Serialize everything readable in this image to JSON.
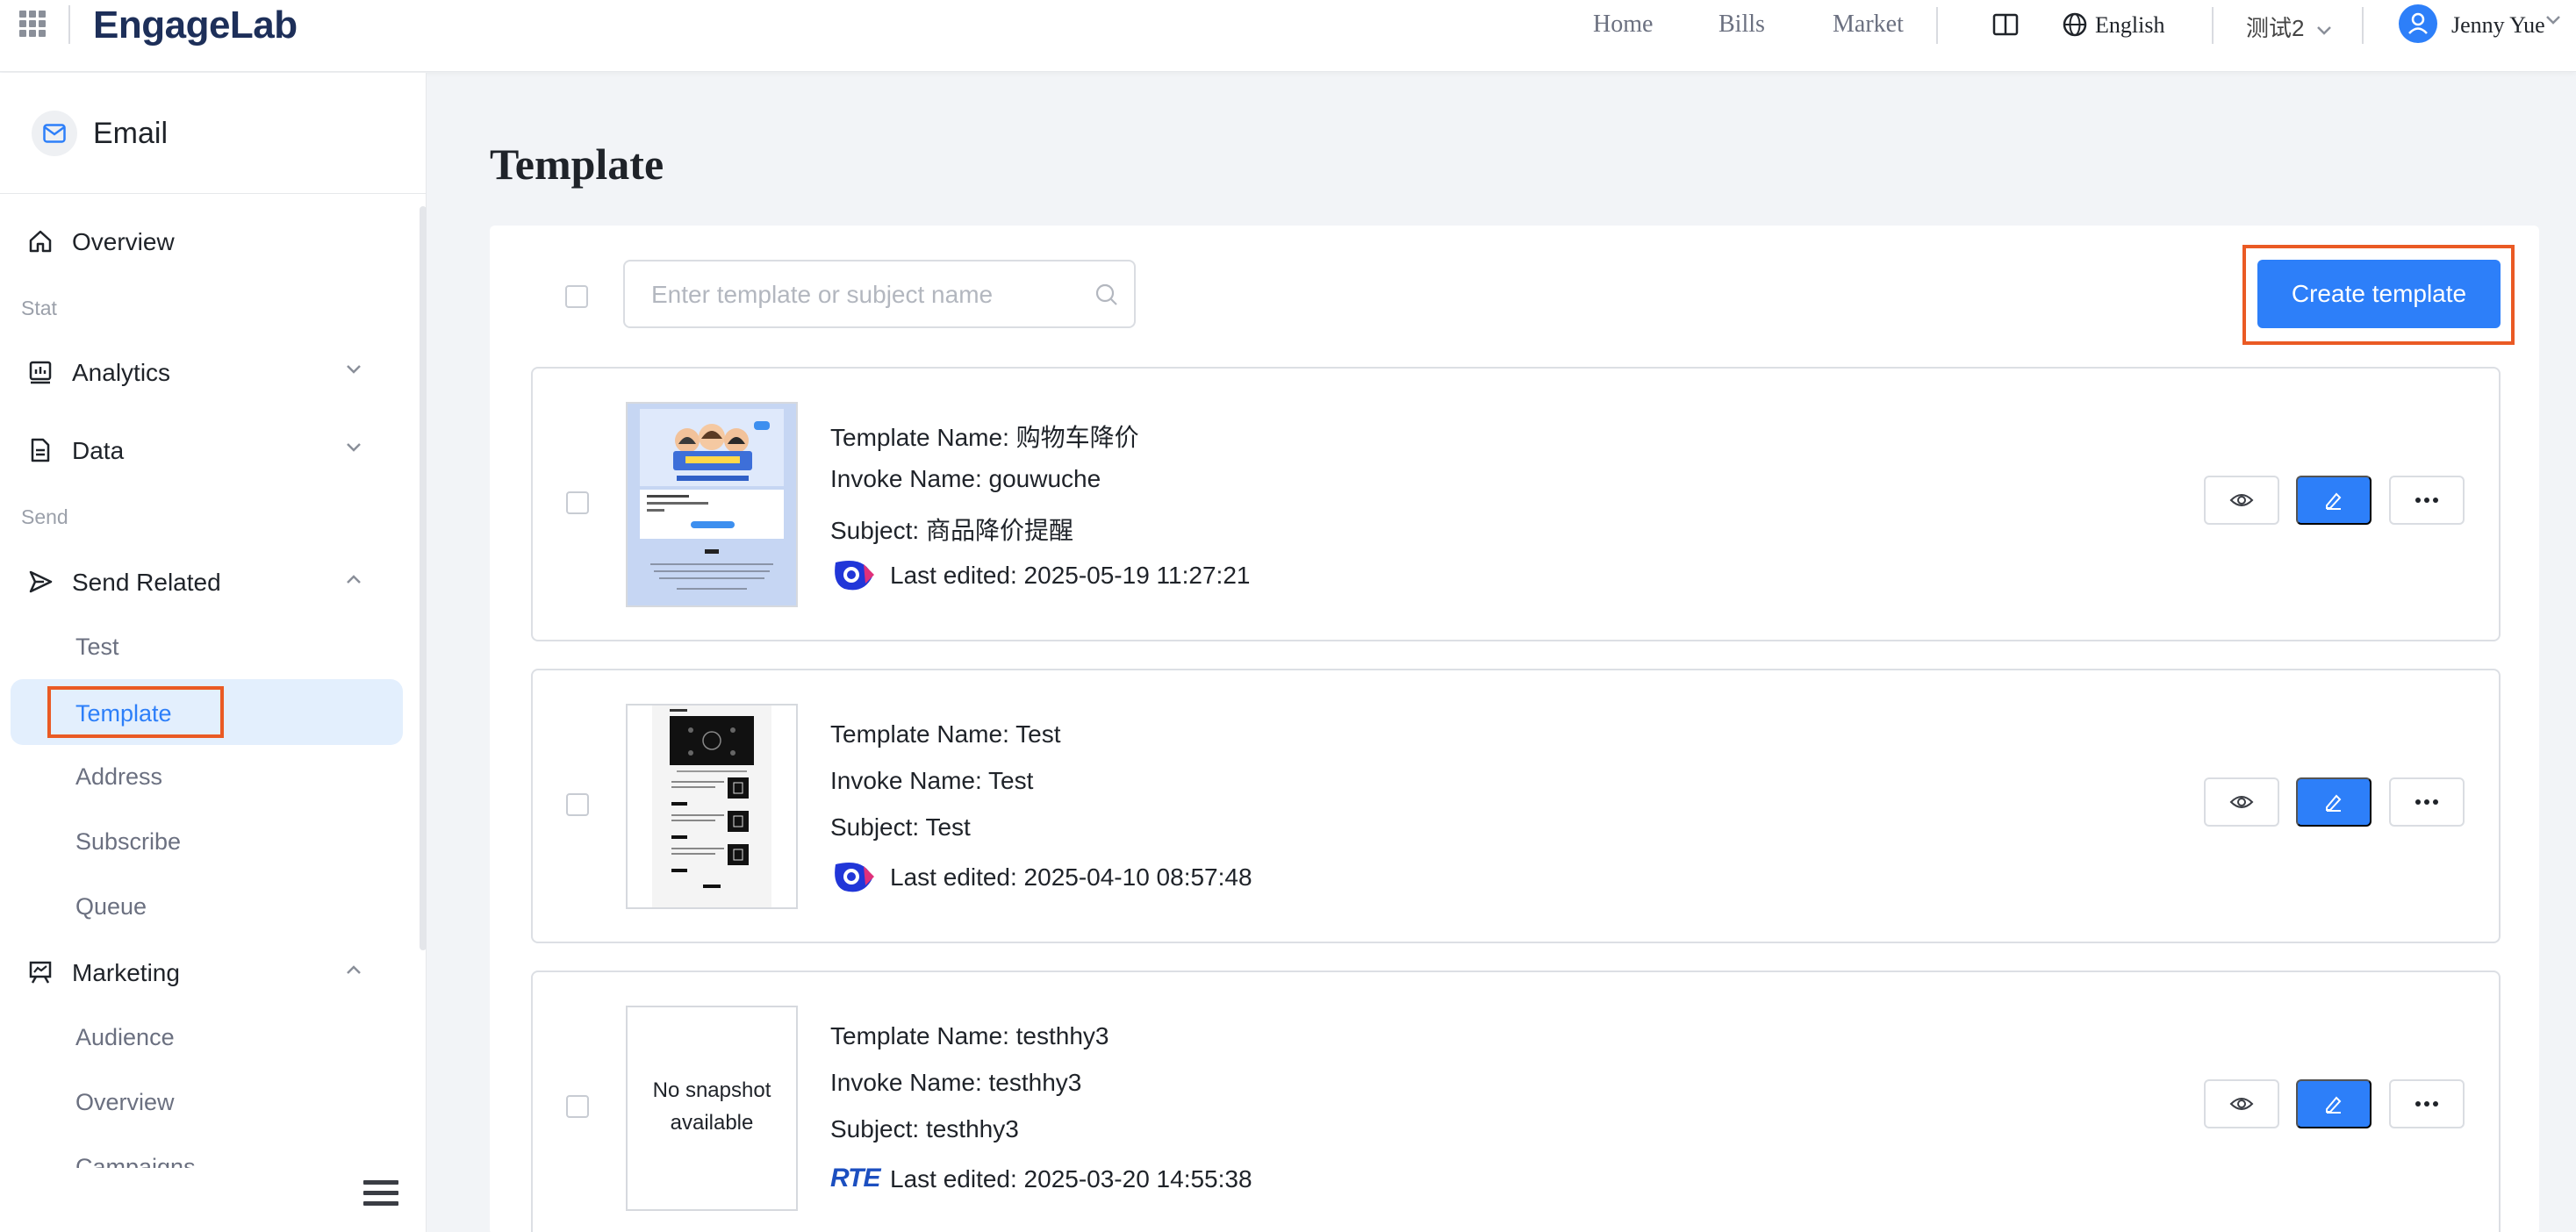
{
  "header": {
    "logo": "EngageLab",
    "nav": [
      "Home",
      "Bills",
      "Market"
    ],
    "language": "English",
    "workspace": "测试2",
    "user": "Jenny Yue"
  },
  "sidebar": {
    "title": "Email",
    "overview": "Overview",
    "groups": {
      "stat": "Stat",
      "send": "Send"
    },
    "analytics": "Analytics",
    "data": "Data",
    "send_related": "Send Related",
    "send_items": [
      "Test",
      "Template",
      "Address",
      "Subscribe",
      "Queue"
    ],
    "marketing": "Marketing",
    "marketing_items": [
      "Audience",
      "Overview",
      "Campaigns"
    ],
    "active_item": "Template"
  },
  "main": {
    "title": "Template",
    "search_placeholder": "Enter template or subject name",
    "create_button": "Create template",
    "templates": [
      {
        "name": "Template Name: 购物车降价",
        "invoke": "Invoke Name: gouwuche",
        "subject": "Subject: 商品降价提醒",
        "edited": "Last edited: 2025-05-19 11:27:21",
        "editor_icon": "drag-editor-logo"
      },
      {
        "name": "Template Name: Test",
        "invoke": "Invoke Name: Test",
        "subject": "Subject: Test",
        "edited": "Last edited: 2025-04-10 08:57:48",
        "editor_icon": "drag-editor-logo"
      },
      {
        "name": "Template Name: testhhy3",
        "invoke": "Invoke Name: testhhy3",
        "subject": "Subject: testhhy3",
        "edited": "Last edited: 2025-03-20 14:55:38",
        "editor_icon": "rte-logo",
        "editor_text": "RTE",
        "snapshot_text": "No snapshot available"
      }
    ]
  },
  "colors": {
    "accent": "#2d7ff9",
    "highlight": "#ea5a24",
    "active_bg": "#e3effd"
  }
}
